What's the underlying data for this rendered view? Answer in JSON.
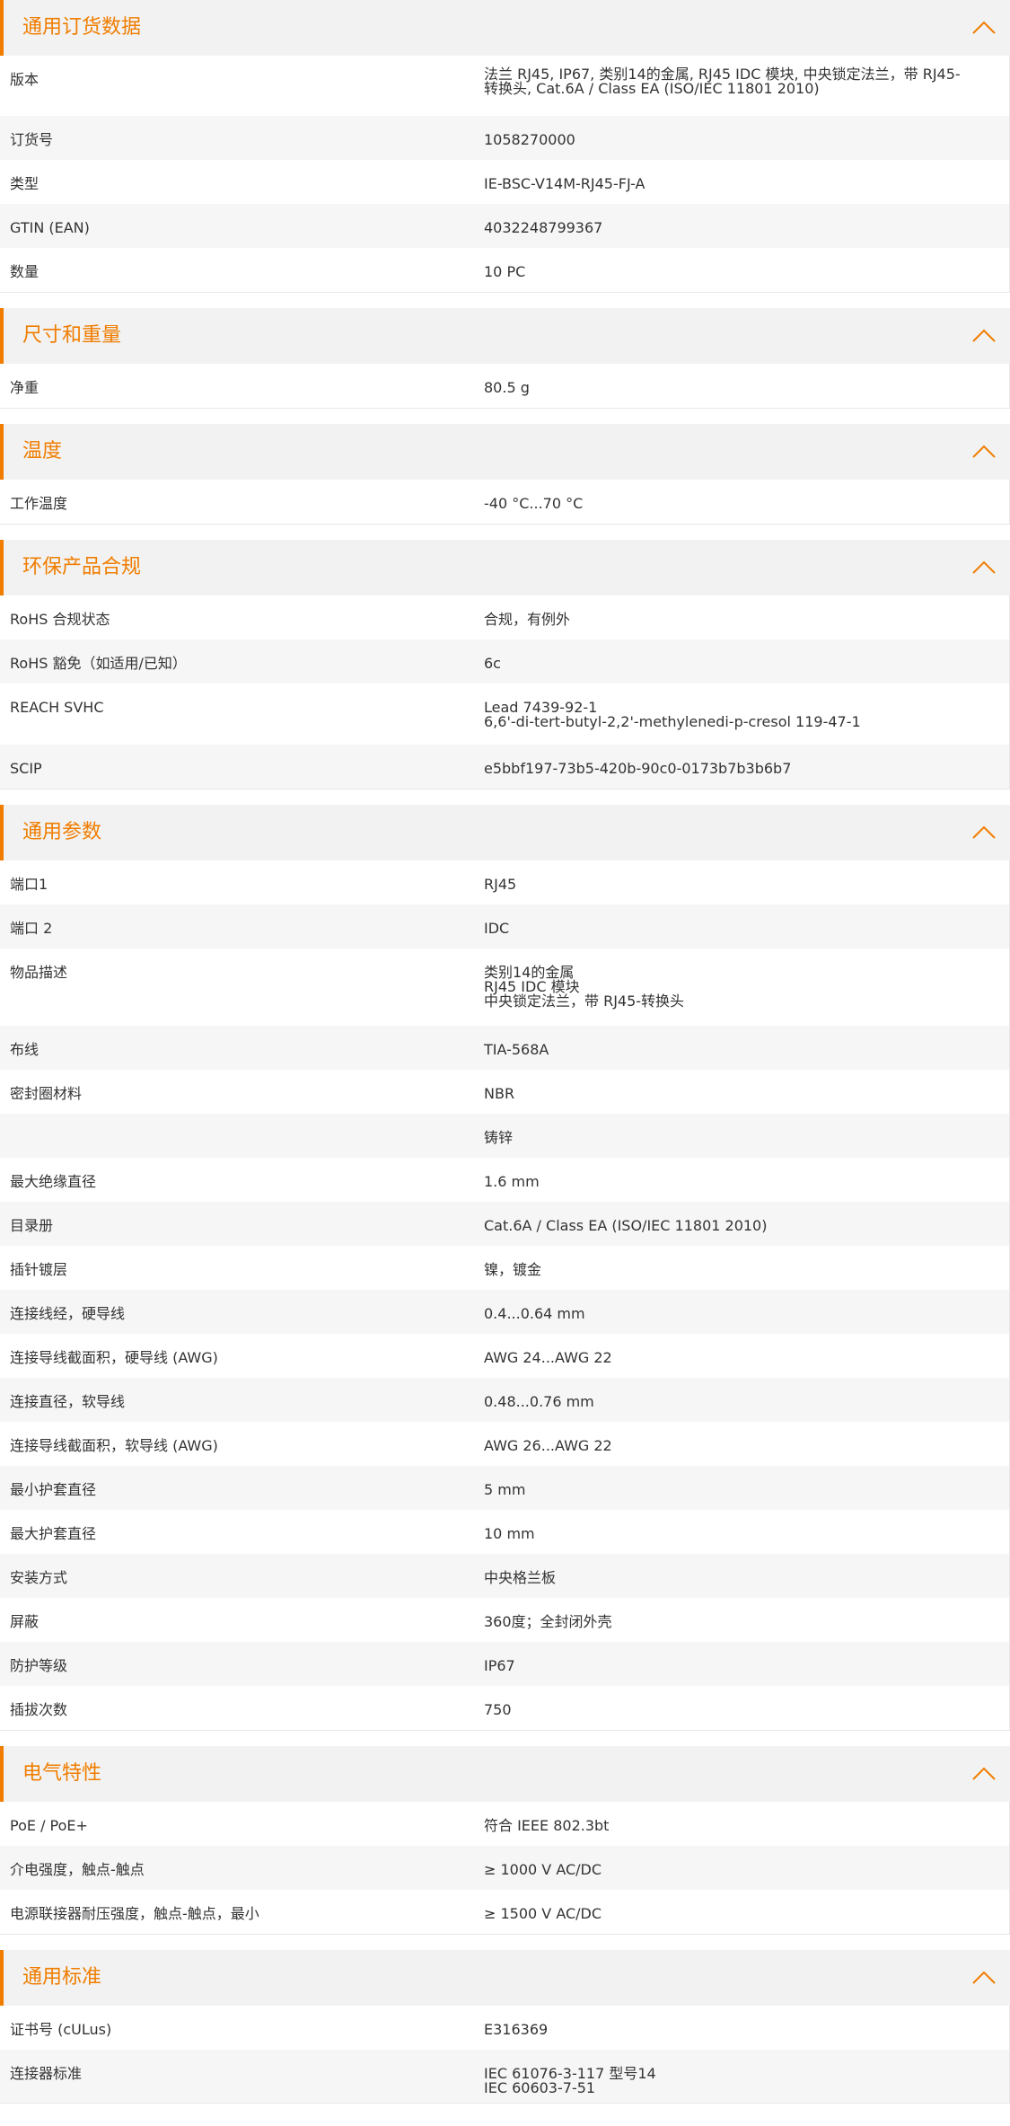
{
  "accent_color": "#f07d00",
  "sections": [
    {
      "title": "通用订货数据",
      "icon": "chevron-up-icon",
      "rows": [
        {
          "label": "版本",
          "value": "法兰 RJ45, IP67, 类别14的金属, RJ45 IDC 模块, 中央锁定法兰，带 RJ45-\n转换头, Cat.6A / Class EA (ISO/IEC 11801 2010)"
        },
        {
          "label": "订货号",
          "value": "1058270000"
        },
        {
          "label": "类型",
          "value": "IE-BSC-V14M-RJ45-FJ-A"
        },
        {
          "label": "GTIN (EAN)",
          "value": "4032248799367"
        },
        {
          "label": "数量",
          "value": "10  PC"
        }
      ]
    },
    {
      "title": "尺寸和重量",
      "icon": "chevron-up-icon",
      "rows": [
        {
          "label": "净重",
          "value": "80.5  g"
        }
      ]
    },
    {
      "title": "温度",
      "icon": "chevron-up-icon",
      "rows": [
        {
          "label": "工作温度",
          "value": "-40 °C...70 °C"
        }
      ]
    },
    {
      "title": "环保产品合规",
      "icon": "chevron-up-icon",
      "rows": [
        {
          "label": "RoHS 合规状态",
          "value": "合规，有例外"
        },
        {
          "label": "RoHS 豁免（如适用/已知）",
          "value": "6c"
        },
        {
          "label": "REACH SVHC",
          "value": "Lead 7439-92-1\n6,6'-di-tert-butyl-2,2'-methylenedi-p-cresol 119-47-1"
        },
        {
          "label": "SCIP",
          "value": "e5bbf197-73b5-420b-90c0-0173b7b3b6b7"
        }
      ]
    },
    {
      "title": "通用参数",
      "icon": "chevron-up-icon",
      "rows": [
        {
          "label": "端口1",
          "value": "RJ45"
        },
        {
          "label": "端口 2",
          "value": "IDC"
        },
        {
          "label": "物品描述",
          "value": "类别14的金属\nRJ45 IDC 模块\n中央锁定法兰，带 RJ45-转换头"
        },
        {
          "label": "布线",
          "value": "TIA-568A"
        },
        {
          "label": "密封圈材料",
          "value": "NBR"
        },
        {
          "label": "",
          "value": "铸锌"
        },
        {
          "label": "最大绝缘直径",
          "value": "1.6  mm"
        },
        {
          "label": "目录册",
          "value": "Cat.6A / Class EA (ISO/IEC 11801 2010)"
        },
        {
          "label": "插针镀层",
          "value": "镍，镀金"
        },
        {
          "label": "连接线经，硬导线",
          "value": "0.4...0.64 mm"
        },
        {
          "label": "连接导线截面积，硬导线 (AWG)",
          "value": "AWG 24...AWG 22"
        },
        {
          "label": "连接直径，软导线",
          "value": "0.48...0.76 mm"
        },
        {
          "label": "连接导线截面积，软导线 (AWG)",
          "value": "AWG 26...AWG 22"
        },
        {
          "label": "最小护套直径",
          "value": "5  mm"
        },
        {
          "label": "最大护套直径",
          "value": "10  mm"
        },
        {
          "label": "安装方式",
          "value": "中央格兰板"
        },
        {
          "label": "屏蔽",
          "value": "360度；全封闭外壳"
        },
        {
          "label": "防护等级",
          "value": "IP67"
        },
        {
          "label": "插拔次数",
          "value": "750"
        }
      ]
    },
    {
      "title": "电气特性",
      "icon": "chevron-up-icon",
      "rows": [
        {
          "label": "PoE / PoE+",
          "value": "符合 IEEE 802.3bt"
        },
        {
          "label": "介电强度，触点-触点",
          "value": "≥ 1000 V AC/DC"
        },
        {
          "label": "电源联接器耐压强度，触点-触点，最小",
          "value": "≥ 1500 V AC/DC"
        }
      ]
    },
    {
      "title": "通用标准",
      "icon": "chevron-up-icon",
      "rows": [
        {
          "label": "证书号 (cULus)",
          "value": "E316369"
        },
        {
          "label": "连接器标准",
          "value": "IEC 61076-3-117 型号14\nIEC 60603-7-51"
        }
      ]
    }
  ]
}
